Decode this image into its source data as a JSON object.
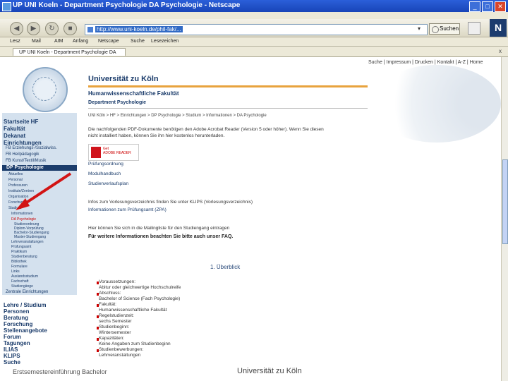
{
  "window": {
    "title": "UP UNI Koeln - Department Psychologie DA Psychologie - Netscape",
    "minimize": "_",
    "maximize": "□",
    "close": "✕"
  },
  "toolbar": {
    "back_icon": "back-arrow-icon",
    "forward_icon": "forward-arrow-icon",
    "reload_icon": "reload-icon",
    "stop_icon": "stop-icon",
    "url": "http://www.uni-koeln.de/phil-fak/...",
    "search_label": "Suchen",
    "dropdown": "▾"
  },
  "bookmarks": [
    "Lesz",
    "Mail",
    "AIM",
    "Anfang",
    "Netscape",
    "Suche",
    "Lesezeichen"
  ],
  "tab": {
    "label": "UP UNI Koeln - Department Psychologie DA",
    "close": "x"
  },
  "topnav": "Suche | Impressum | Drucken | Kontakt | A-Z | Home",
  "header": {
    "university": "Universität zu Köln",
    "faculty": "Humanwissenschaftliche Fakultät",
    "department": "Department Psychologie"
  },
  "sidebar": {
    "top": [
      "Startseite HF",
      "Fakultät",
      "Dekanat",
      "Einrichtungen"
    ],
    "sub1": [
      "FB Erziehungs-/Sozialwiss.",
      "FB Heilpädagogik",
      "FB Kunst/Textil/Musik"
    ],
    "selected": "DP Psychologie",
    "sub2": [
      "Aktuelles",
      "Personal",
      "Professuren",
      "Institute/Zentren",
      "Organisation",
      "Forschung",
      "Studium"
    ],
    "sub3": [
      "Informationen",
      "DA Psychologie"
    ],
    "sub4": [
      "Studienordnung",
      "Diplom-Vorprüfung",
      "Bachelor-Studiengang",
      "Master-Studiengang",
      "Lehrveranstaltungen",
      "Prüfungsamt",
      "Praktikum",
      "Studienberatung",
      "Bibliothek",
      "Formulare",
      "Links",
      "Auslandsstudium",
      "Fachschaft",
      "Studiengänge"
    ],
    "after": [
      "Zentrale Einrichtungen"
    ],
    "lower": [
      "Lehre / Studium",
      "Personen",
      "Beratung",
      "Forschung",
      "Stellenangebote",
      "Forum",
      "Tagungen",
      "ILIAS",
      "KLIPS",
      "Suche"
    ]
  },
  "breadcrumb": "UNI Köln > HF > Einrichtungen > DP Psychologie > Studium > Informationen > DA Psychologie",
  "intro": [
    "Die nachfolgenden PDF-Dokumente benötigen den Adobe Acrobat Reader (Version 5 oder höher). Wenn Sie diesen",
    "nicht installiert haben, können Sie ihn hier kostenlos herunterladen."
  ],
  "adobe": {
    "line1": "Get",
    "line2": "ADOBE READER"
  },
  "links": [
    "Prüfungsordnung",
    "Modulhandbuch",
    "Studienverlaufsplan"
  ],
  "notice": [
    "Infos zum Vorlesungsverzeichnis finden Sie unter KLIPS (Vorlesungsverzeichnis)",
    "Informationen zum Prüfungsamt (ZPA)"
  ],
  "mailing": "Hier können Sie sich in die Mailingliste für den Studiengang eintragen",
  "faq": "Für weitere Informationen beachten Sie bitte auch unser FAQ.",
  "overview_heading": "1. Überblick",
  "overview": [
    "Voraussetzungen:",
    "Abitur oder gleichwertige Hochschulreife",
    "Abschluss:",
    "Bachelor of Science (Fach Psychologie)",
    "Fakultät:",
    "Humanwissenschaftliche Fakultät",
    "Regelstudienzeit:",
    "sechs Semester",
    "Studienbeginn:",
    "Wintersemester",
    "Kapazitäten:",
    "Keine Angaben zum Studienbeginn",
    "Studienbewerbungen:",
    "Lehrveranstaltungen"
  ],
  "footer_left": "Erstsemestereinführung Bachelor",
  "footer_right": "Universität zu Köln",
  "colors": {
    "brand": "#1b3c6b",
    "accent": "#e8a33d",
    "arrow": "#d21414"
  }
}
